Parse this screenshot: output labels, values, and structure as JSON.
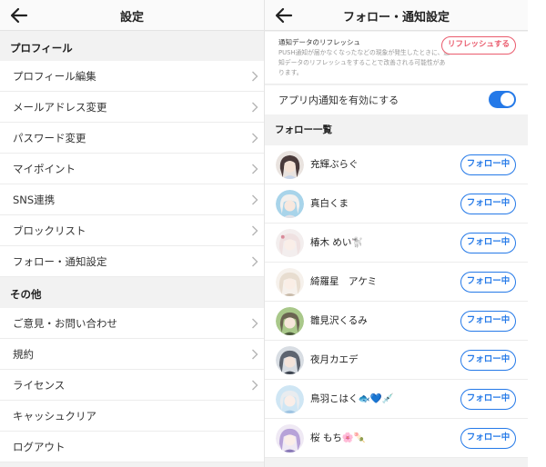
{
  "left": {
    "title": "設定",
    "sections": [
      {
        "heading": "プロフィール",
        "items": [
          {
            "label": "プロフィール編集"
          },
          {
            "label": "メールアドレス変更"
          },
          {
            "label": "パスワード変更"
          },
          {
            "label": "マイポイント"
          },
          {
            "label": "SNS連携"
          },
          {
            "label": "ブロックリスト"
          },
          {
            "label": "フォロー・通知設定"
          }
        ]
      },
      {
        "heading": "その他",
        "items": [
          {
            "label": "ご意見・お問い合わせ"
          },
          {
            "label": "規約"
          },
          {
            "label": "ライセンス"
          },
          {
            "label": "キャッシュクリア"
          },
          {
            "label": "ログアウト"
          }
        ]
      }
    ]
  },
  "right": {
    "title": "フォロー・通知設定",
    "refresh": {
      "title": "通知データのリフレッシュ",
      "description": "PUSH通知が届かなくなったなどの現象が発生したときに、通知データのリフレッシュをすることで改善される可能性があります。",
      "button_label": "リフレッシュする"
    },
    "in_app_toggle": {
      "label": "アプリ内通知を有効にする",
      "enabled": true
    },
    "follow_heading": "フォロー一覧",
    "follows": [
      {
        "name": "充輝ぶらぐ",
        "button": "フォロー中"
      },
      {
        "name": "真白くま",
        "button": "フォロー中"
      },
      {
        "name": "椿木 めい🐩",
        "button": "フォロー中"
      },
      {
        "name": "綺羅星　アケミ",
        "button": "フォロー中"
      },
      {
        "name": "雛見沢くるみ",
        "button": "フォロー中"
      },
      {
        "name": "夜月カエデ",
        "button": "フォロー中"
      },
      {
        "name": "鳥羽こはく🐟💙💉",
        "button": "フォロー中"
      },
      {
        "name": "桜 もち🌸🍡",
        "button": "フォロー中"
      }
    ]
  },
  "colors": {
    "accent_blue": "#2479e8",
    "refresh_red": "#ea5b6d",
    "background_gray": "#f2f2f2"
  },
  "icons": {
    "back": "arrow-left-icon",
    "row_chevron": "chevron-right-icon"
  }
}
